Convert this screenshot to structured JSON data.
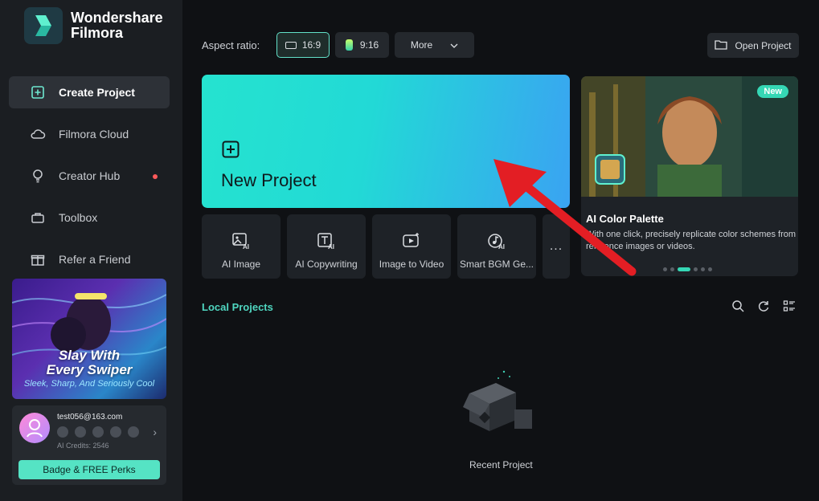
{
  "brand": {
    "line1": "Wondershare",
    "line2": "Filmora"
  },
  "sidebar": {
    "items": [
      {
        "label": "Create Project",
        "icon": "plus-square-icon",
        "active": true
      },
      {
        "label": "Filmora Cloud",
        "icon": "cloud-icon"
      },
      {
        "label": "Creator Hub",
        "icon": "lightbulb-icon",
        "notify": true
      },
      {
        "label": "Toolbox",
        "icon": "toolbox-icon"
      },
      {
        "label": "Refer a Friend",
        "icon": "gift-icon"
      }
    ],
    "promo": {
      "line1": "Slay With",
      "line2": "Every Swiper",
      "line3": "Sleek, Sharp, And Seriously Cool"
    },
    "account": {
      "email": "test056@163.com",
      "credits": "AI Credits: 2546",
      "perks_button": "Badge & FREE Perks"
    }
  },
  "topbar": {
    "aspect_label": "Aspect ratio:",
    "ratio_169": "16:9",
    "ratio_916": "9:16",
    "more": "More",
    "open_project": "Open Project"
  },
  "new_project": {
    "title": "New Project"
  },
  "feature": {
    "tag": "New",
    "title": "AI Color Palette",
    "description": "With one click, precisely replicate color schemes from reference images or videos."
  },
  "tools": [
    {
      "label": "AI Image",
      "icon": "ai-image-icon"
    },
    {
      "label": "AI Copywriting",
      "icon": "ai-copywriting-icon"
    },
    {
      "label": "Image to Video",
      "icon": "image-to-video-icon"
    },
    {
      "label": "Smart BGM Ge...",
      "icon": "smart-bgm-icon"
    }
  ],
  "more_tools": "...",
  "local": {
    "title": "Local Projects",
    "empty_label": "Recent Project"
  },
  "colors": {
    "accent": "#4fd6c0",
    "perks": "#55e3c4",
    "arrow": "#e31e24"
  }
}
